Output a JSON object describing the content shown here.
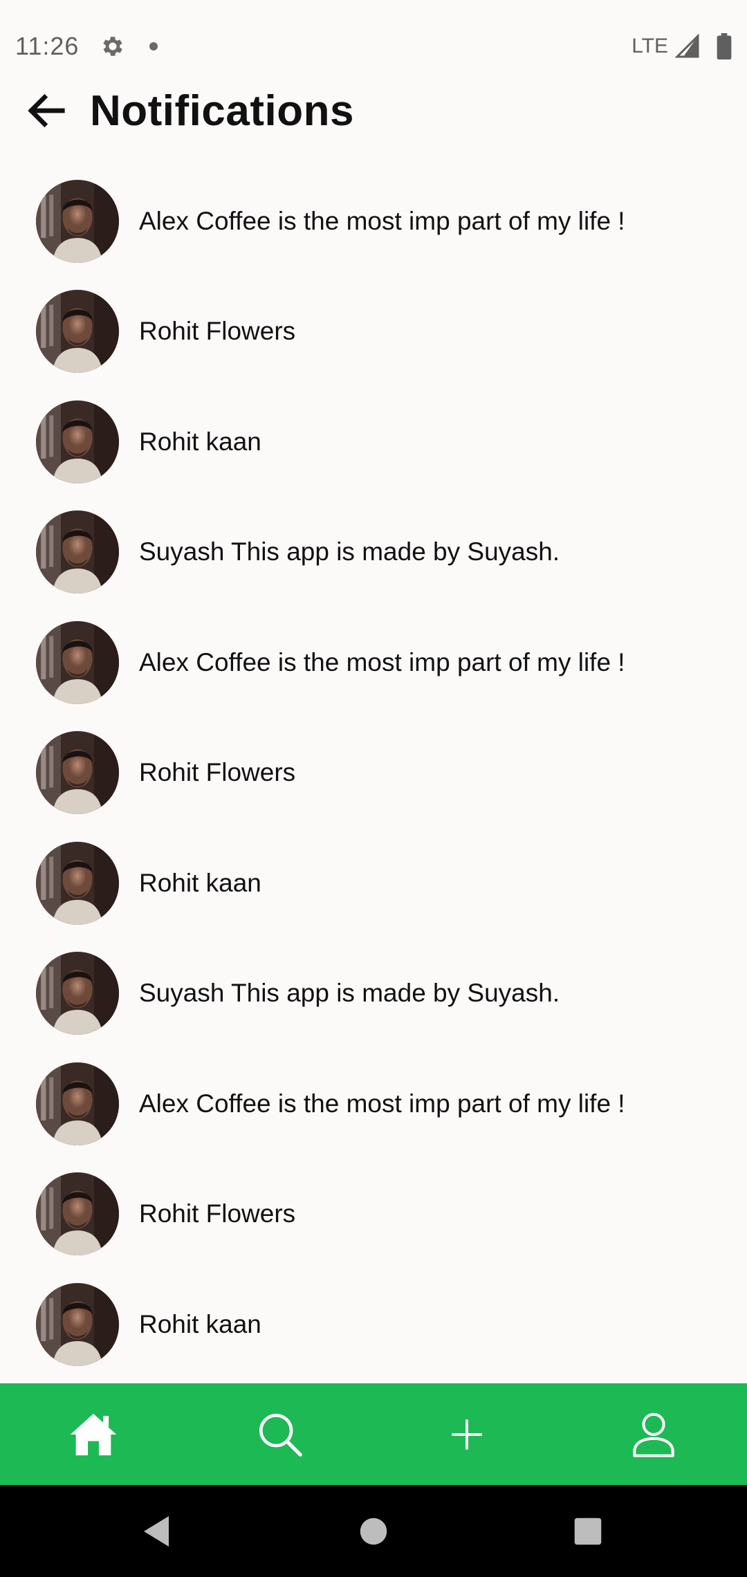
{
  "status_bar": {
    "time": "11:26",
    "network": "LTE"
  },
  "header": {
    "title": "Notifications",
    "back_icon": "arrow-left-icon"
  },
  "notifications": [
    {
      "text": "Alex Coffee is the most imp part of my life !"
    },
    {
      "text": "Rohit Flowers"
    },
    {
      "text": "Rohit kaan"
    },
    {
      "text": "Suyash This app is made by Suyash."
    },
    {
      "text": "Alex Coffee is the most imp part of my life !"
    },
    {
      "text": "Rohit Flowers"
    },
    {
      "text": "Rohit kaan"
    },
    {
      "text": "Suyash This app is made by Suyash."
    },
    {
      "text": "Alex Coffee is the most imp part of my life !"
    },
    {
      "text": "Rohit Flowers"
    },
    {
      "text": "Rohit kaan"
    }
  ],
  "bottom_nav": {
    "background": "#1DB954",
    "items": [
      {
        "icon": "home-icon"
      },
      {
        "icon": "search-icon"
      },
      {
        "icon": "add-icon"
      },
      {
        "icon": "profile-icon"
      }
    ]
  },
  "system_nav": {
    "items": [
      {
        "icon": "back-triangle-icon"
      },
      {
        "icon": "home-circle-icon"
      },
      {
        "icon": "recents-square-icon"
      }
    ]
  }
}
